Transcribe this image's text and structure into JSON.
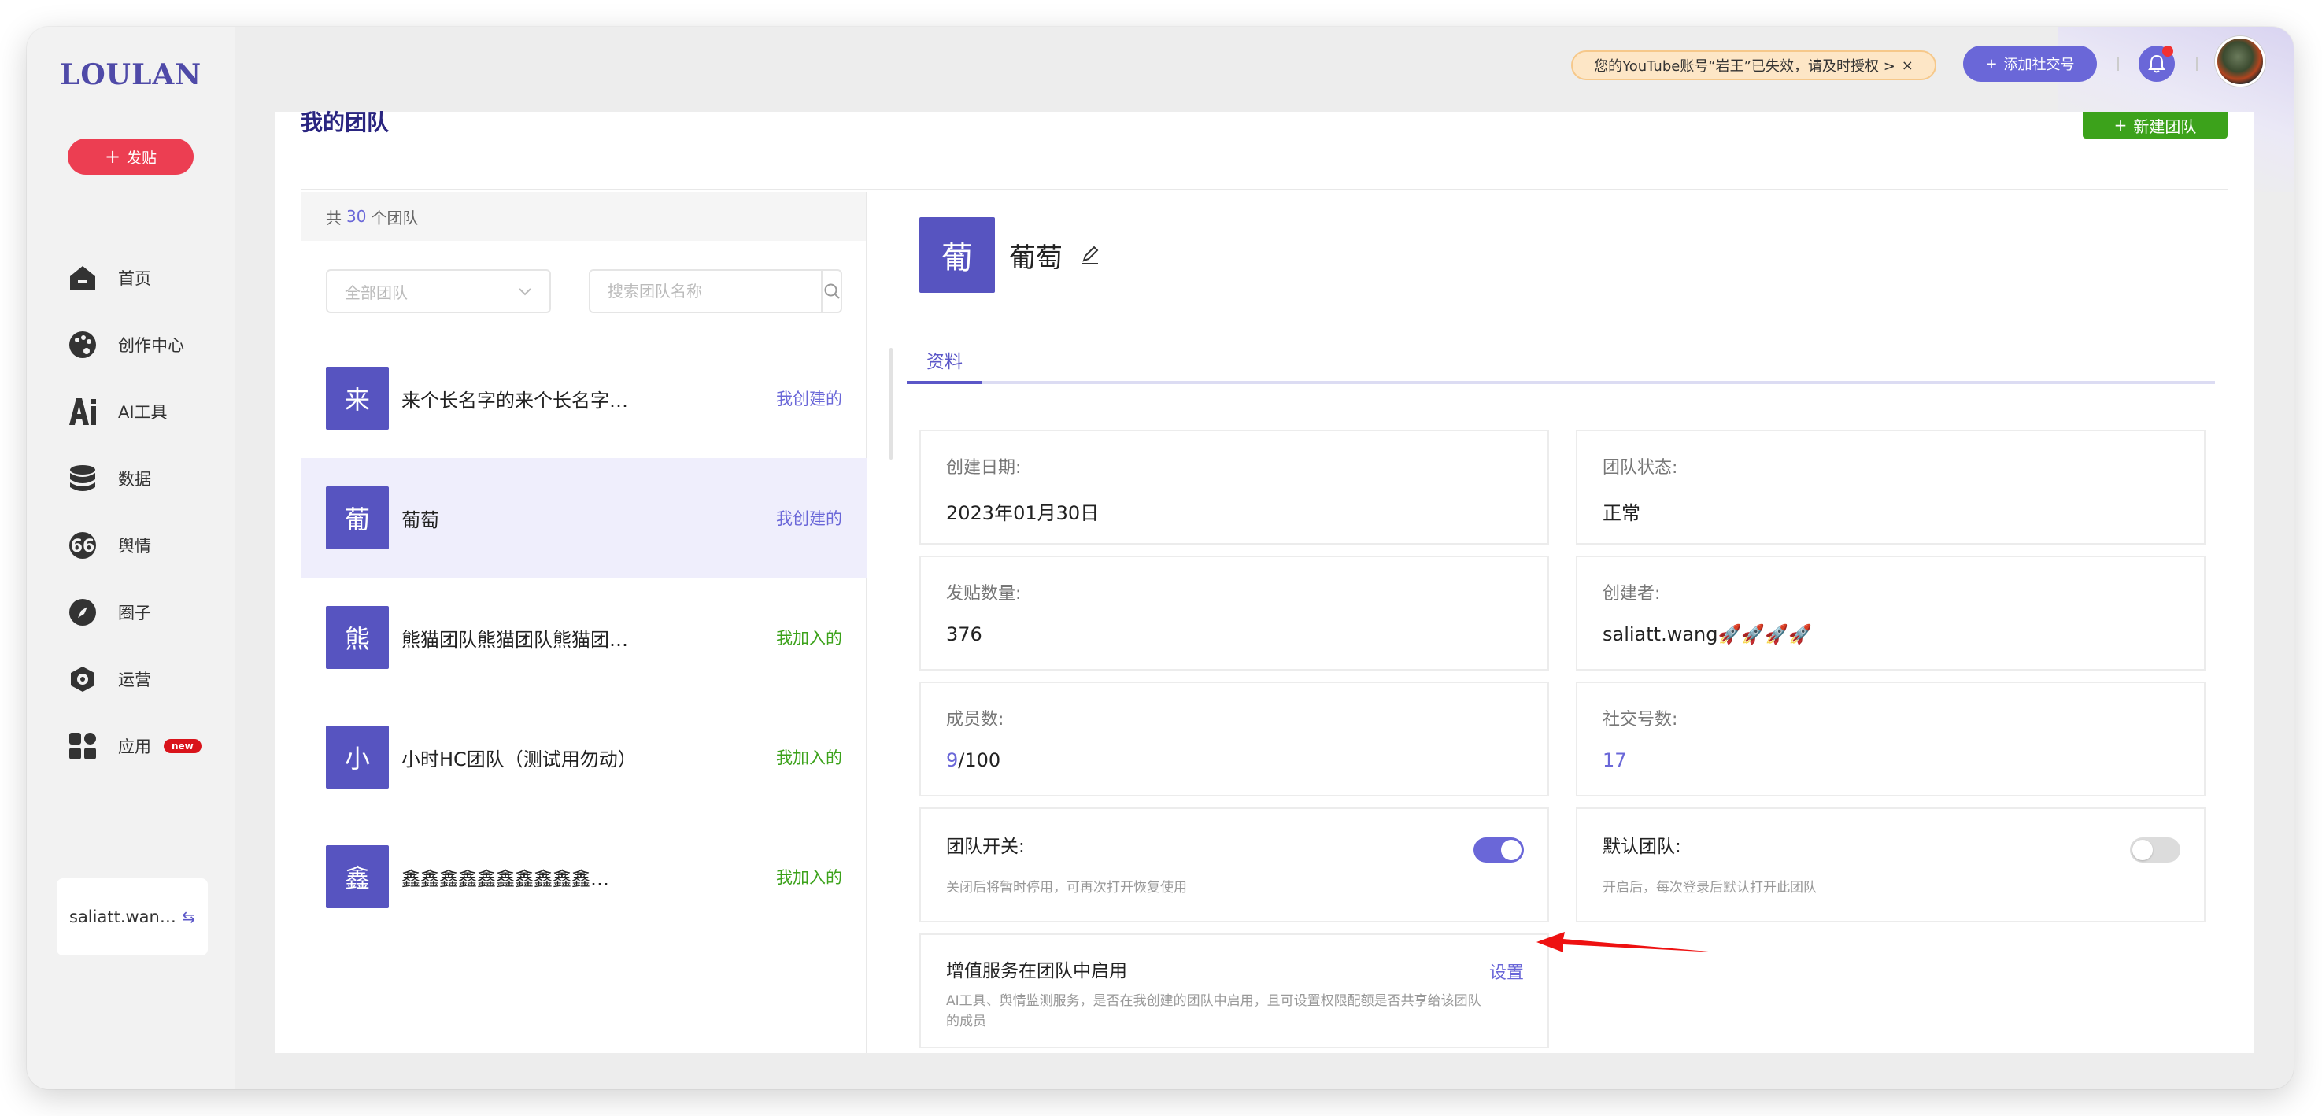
{
  "sidebar": {
    "logo": "LOULAN",
    "post_button": "发贴",
    "items": [
      {
        "label": "首页",
        "icon": "home-icon"
      },
      {
        "label": "创作中心",
        "icon": "palette-icon"
      },
      {
        "label": "AI工具",
        "icon": "ai-icon"
      },
      {
        "label": "数据",
        "icon": "database-icon"
      },
      {
        "label": "舆情",
        "icon": "quote-icon"
      },
      {
        "label": "圈子",
        "icon": "compass-icon"
      },
      {
        "label": "运营",
        "icon": "operations-icon"
      },
      {
        "label": "应用",
        "icon": "apps-icon",
        "badge": "new"
      }
    ],
    "user": "saliatt.wan…"
  },
  "topbar": {
    "notice": "您的YouTube账号“岩王”已失效，请及时授权 >",
    "notice_close": "×",
    "add_social": "添加社交号"
  },
  "page": {
    "title": "我的团队",
    "new_team": "新建团队"
  },
  "team_list": {
    "count_prefix": "共",
    "count": "30",
    "count_suffix": "个团队",
    "filter_value": "全部团队",
    "search_placeholder": "搜索团队名称",
    "teams": [
      {
        "avatar": "来",
        "name": "来个长名字的来个长名字…",
        "role": "我创建的",
        "role_type": "created"
      },
      {
        "avatar": "葡",
        "name": "葡萄",
        "role": "我创建的",
        "role_type": "created"
      },
      {
        "avatar": "熊",
        "name": "熊猫团队熊猫团队熊猫团…",
        "role": "我加入的",
        "role_type": "joined"
      },
      {
        "avatar": "小",
        "name": "小时HC团队（测试用勿动）",
        "role": "我加入的",
        "role_type": "joined"
      },
      {
        "avatar": "鑫",
        "name": "鑫鑫鑫鑫鑫鑫鑫鑫鑫鑫…",
        "role": "我加入的",
        "role_type": "joined"
      }
    ]
  },
  "detail": {
    "avatar": "葡",
    "name": "葡萄",
    "tab": "资料",
    "created_date_label": "创建日期:",
    "created_date": "2023年01月30日",
    "status_label": "团队状态:",
    "status": "正常",
    "posts_label": "发贴数量:",
    "posts": "376",
    "creator_label": "创建者:",
    "creator": "saliatt.wang🚀🚀🚀🚀",
    "members_label": "成员数:",
    "members_current": "9",
    "members_total": "/100",
    "social_label": "社交号数:",
    "social_count": "17",
    "switch_label": "团队开关:",
    "switch_hint": "关闭后将暂时停用，可再次打开恢复使用",
    "default_label": "默认团队:",
    "default_hint": "开启后，每次登录后默认打开此团队",
    "vas_label": "增值服务在团队中启用",
    "vas_link": "设置",
    "vas_hint": "AI工具、舆情监测服务，是否在我创建的团队中启用，且可设置权限配额是否共享给该团队的成员"
  },
  "colors": {
    "accent": "#6a67d8",
    "avatar": "#5754c0",
    "post": "#ec3e52",
    "green": "#3ca21b"
  }
}
